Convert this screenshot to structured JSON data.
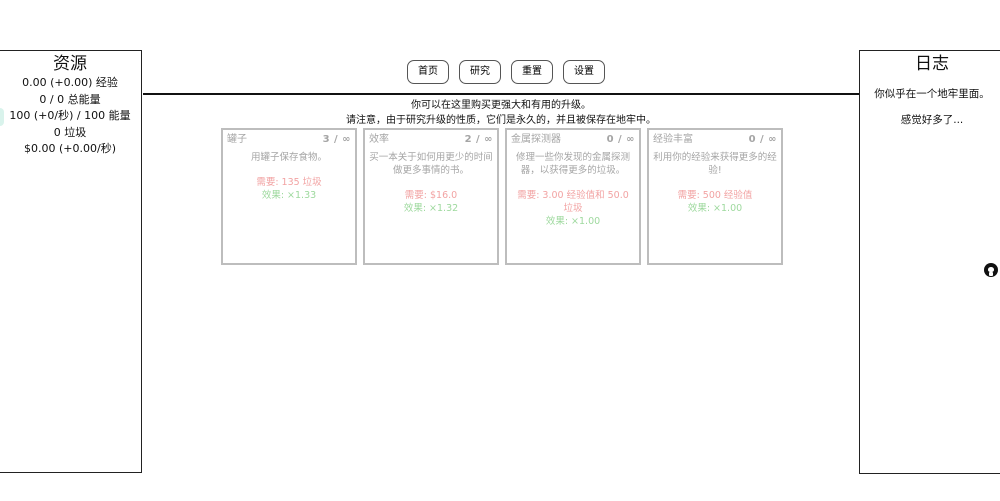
{
  "resources": {
    "title": "资源",
    "lines": [
      "0.00 (+0.00) 经验",
      "0 / 0 总能量",
      "100 (+0/秒) / 100 能量",
      "0 垃圾",
      "$0.00 (+0.00/秒)"
    ]
  },
  "nav": {
    "home": "首页",
    "research": "研究",
    "reset": "重置",
    "settings": "设置"
  },
  "intro": {
    "line1": "你可以在这里购买更强大和有用的升级。",
    "line2": "请注意，由于研究升级的性质，它们是永久的，并且被保存在地牢中。"
  },
  "upgrades": [
    {
      "name": "罐子",
      "level": "3 / ∞",
      "desc": "用罐子保存食物。",
      "cost": "需要: 135 垃圾",
      "effect": "效果: ×1.33"
    },
    {
      "name": "效率",
      "level": "2 / ∞",
      "desc": "买一本关于如何用更少的时间做更多事情的书。",
      "cost": "需要: $16.0",
      "effect": "效果: ×1.32"
    },
    {
      "name": "金属探测器",
      "level": "0 / ∞",
      "desc": "修理一些你发现的金属探测器，以获得更多的垃圾。",
      "cost": "需要: 3.00 经验值和 50.0 垃圾",
      "effect": "效果: ×1.00"
    },
    {
      "name": "经验丰富",
      "level": "0 / ∞",
      "desc": "利用你的经验来获得更多的经验!",
      "cost": "需要: 500 经验值",
      "effect": "效果: ×1.00"
    }
  ],
  "log": {
    "title": "日志",
    "entries": [
      "你似乎在一个地牢里面。",
      "感觉好多了..."
    ]
  },
  "icons": {
    "github": "github-icon"
  }
}
